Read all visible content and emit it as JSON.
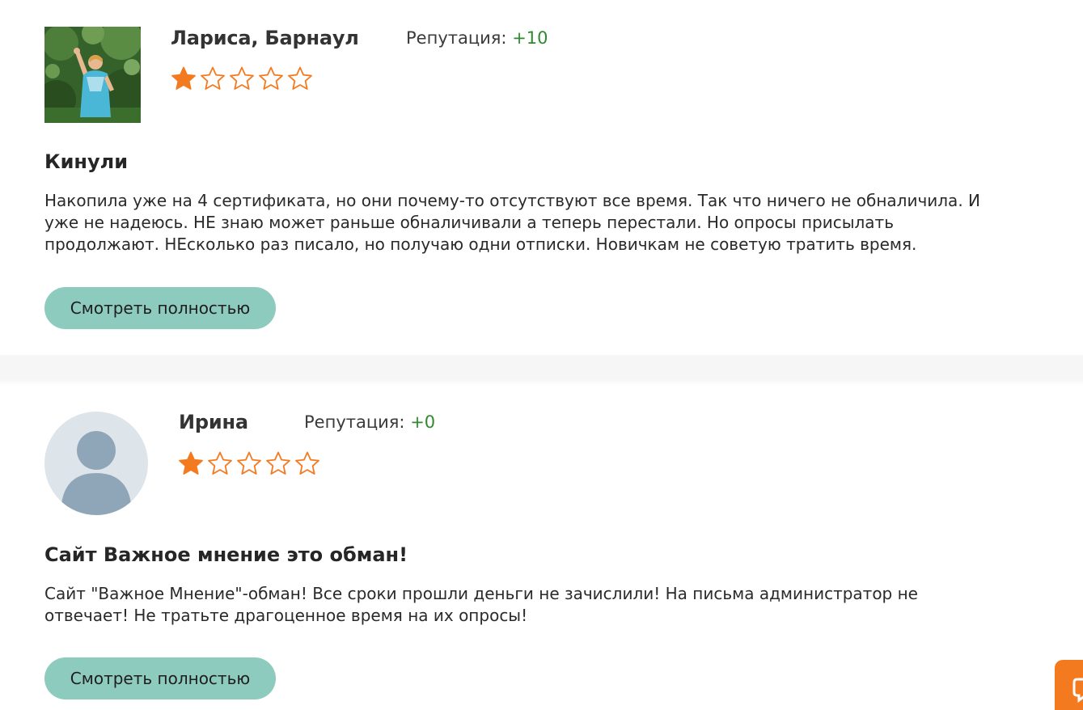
{
  "reviews": [
    {
      "author": "Лариса, Барнаул",
      "reputation_label": "Репутация:",
      "reputation_value": "+10",
      "rating": 1,
      "rating_max": 5,
      "title": "Кинули",
      "text": "Накопила уже на 4 сертификата, но они почему-то отсутствуют все время. Так что ничего не обналичила. И\nуже не надеюсь. НЕ знаю может раньше обналичивали а теперь перестали. Но опросы присылать\nпродолжают. НЕсколько раз писало, но получаю одни отписки. Новичкам не советую тратить время.",
      "more_label": "Смотреть полностью"
    },
    {
      "author": "Ирина",
      "reputation_label": "Репутация:",
      "reputation_value": "+0",
      "rating": 1,
      "rating_max": 5,
      "title": "Сайт Важное мнение это обман!",
      "text": "Сайт \"Важное Мнение\"-обман! Все сроки прошли деньги не зачислили! На письма администратор не\nотвечает! Не тратьте драгоценное время на их опросы!",
      "more_label": "Смотреть полностью"
    }
  ],
  "colors": {
    "star": "#f47a20",
    "button": "#8ecbbf",
    "reputation_positive": "#2f8a2f",
    "chat_widget": "#f47a20"
  },
  "icons": {
    "star_filled": "star-filled-icon",
    "star_empty": "star-outline-icon",
    "default_avatar": "user-silhouette-icon",
    "chat": "chat-bubble-icon"
  }
}
